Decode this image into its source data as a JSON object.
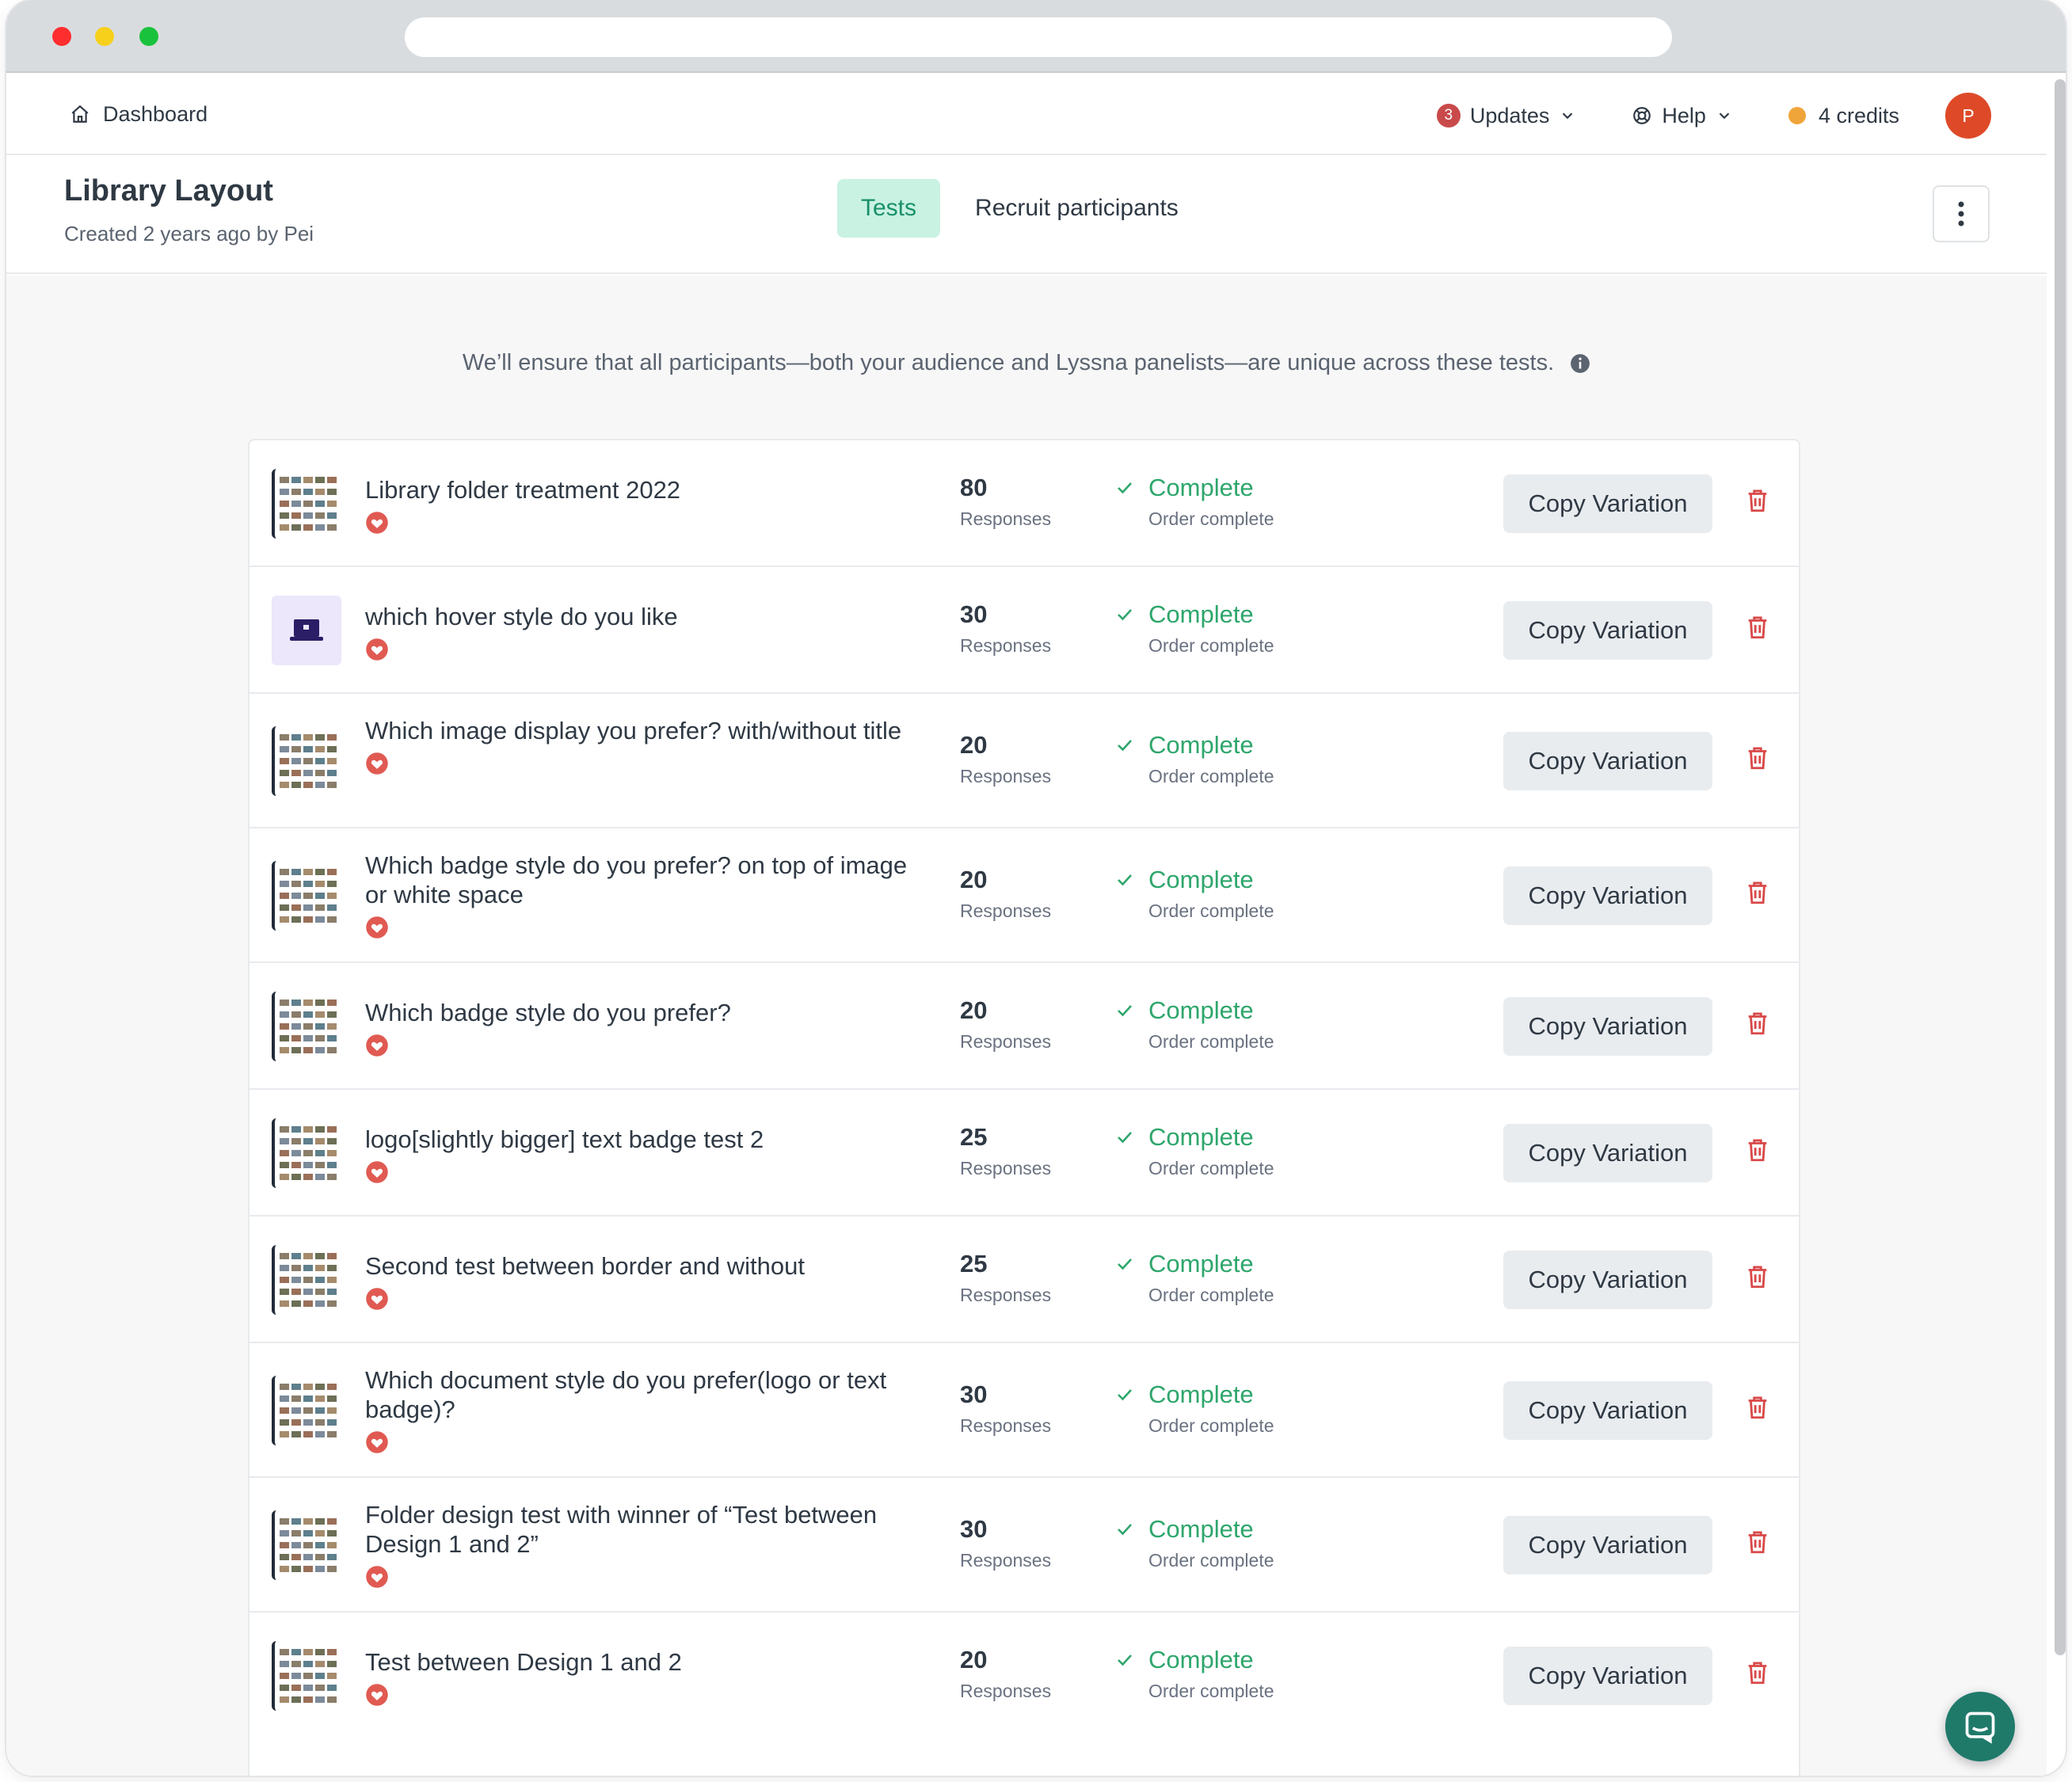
{
  "nav": {
    "dashboard_label": "Dashboard",
    "updates_count": "3",
    "updates_label": "Updates",
    "help_label": "Help",
    "credits_label": "4 credits",
    "avatar_initial": "P"
  },
  "header": {
    "title": "Library Layout",
    "subtitle": "Created 2 years ago by Pei",
    "tabs": [
      {
        "label": "Tests",
        "active": true
      },
      {
        "label": "Recruit participants",
        "active": false
      }
    ]
  },
  "notice": "We’ll ensure that all participants—both your audience and Lyssna panelists—are unique across these tests.",
  "tests": [
    {
      "title": "Library folder treatment 2022",
      "responses": "80",
      "responses_label": "Responses",
      "status": "Complete",
      "status_sub": "Order complete",
      "copy_label": "Copy Variation",
      "thumb": "screens"
    },
    {
      "title": "which hover style do you like",
      "responses": "30",
      "responses_label": "Responses",
      "status": "Complete",
      "status_sub": "Order complete",
      "copy_label": "Copy Variation",
      "thumb": "laptop"
    },
    {
      "title": "Which image display you prefer? with/without title",
      "responses": "20",
      "responses_label": "Responses",
      "status": "Complete",
      "status_sub": "Order complete",
      "copy_label": "Copy Variation",
      "thumb": "screens"
    },
    {
      "title": "Which badge style do you prefer? on top of image or white space",
      "responses": "20",
      "responses_label": "Responses",
      "status": "Complete",
      "status_sub": "Order complete",
      "copy_label": "Copy Variation",
      "thumb": "screens"
    },
    {
      "title": "Which badge style do you prefer?",
      "responses": "20",
      "responses_label": "Responses",
      "status": "Complete",
      "status_sub": "Order complete",
      "copy_label": "Copy Variation",
      "thumb": "screens"
    },
    {
      "title": "logo[slightly bigger] text badge test 2",
      "responses": "25",
      "responses_label": "Responses",
      "status": "Complete",
      "status_sub": "Order complete",
      "copy_label": "Copy Variation",
      "thumb": "screens"
    },
    {
      "title": "Second test between border and without",
      "responses": "25",
      "responses_label": "Responses",
      "status": "Complete",
      "status_sub": "Order complete",
      "copy_label": "Copy Variation",
      "thumb": "screens"
    },
    {
      "title": "Which document style do you prefer(logo or text badge)?",
      "responses": "30",
      "responses_label": "Responses",
      "status": "Complete",
      "status_sub": "Order complete",
      "copy_label": "Copy Variation",
      "thumb": "screens"
    },
    {
      "title": "Folder design test with winner of “Test between Design 1 and 2”",
      "responses": "30",
      "responses_label": "Responses",
      "status": "Complete",
      "status_sub": "Order complete",
      "copy_label": "Copy Variation",
      "thumb": "screens"
    },
    {
      "title": "Test between Design 1 and 2",
      "responses": "20",
      "responses_label": "Responses",
      "status": "Complete",
      "status_sub": "Order complete",
      "copy_label": "Copy Variation",
      "thumb": "screens"
    }
  ],
  "colors": {
    "accent_green": "#2ea66c",
    "tab_active_bg": "#c9f2e2",
    "danger_red": "#d94848",
    "avatar_bg": "#de4a28",
    "chat_bg": "#1f7a6a"
  }
}
